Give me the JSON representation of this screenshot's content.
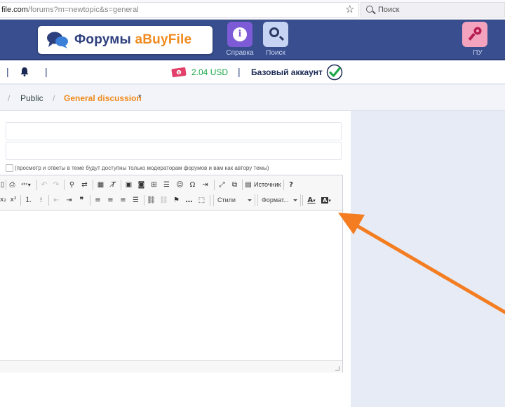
{
  "browser": {
    "url_host": "file.com",
    "url_rest": "/forums?m=newtopic&s=general",
    "search_placeholder": "Поиск"
  },
  "header": {
    "logo_text": "Форумы ",
    "logo_accent": "aBuyFile",
    "help_label": "Справка",
    "search_label": "Поиск",
    "login_label": "ПУ",
    "colors": {
      "header_bg": "#384e8e",
      "help_btn": "#7d5bd6",
      "login_btn": "#f3a3bd",
      "accent": "#f08a1c"
    }
  },
  "status": {
    "balance": "2.04 USD",
    "account": "Базовый аккаунт",
    "balance_color": "#1ea84a"
  },
  "breadcrumb": {
    "sep": "/",
    "public": "Public",
    "current": "General discussion",
    "star": "*"
  },
  "form": {
    "subject_value": "",
    "description_value": "",
    "moderation_note": "(просмотр и ответы в теме будут доступны только модераторам форумов и вам как автору темы)"
  },
  "toolbar": {
    "source_label": "Источник",
    "help_label": "?",
    "styles_label": "Стили",
    "format_label": "Формат...",
    "text_color_label": "A",
    "bg_color_label": "A"
  },
  "icons": [
    "star-icon",
    "search-icon",
    "bell-icon",
    "money-icon",
    "check-icon",
    "key-icon",
    "help-icon",
    "resize-icon",
    "arrow-annotation"
  ]
}
